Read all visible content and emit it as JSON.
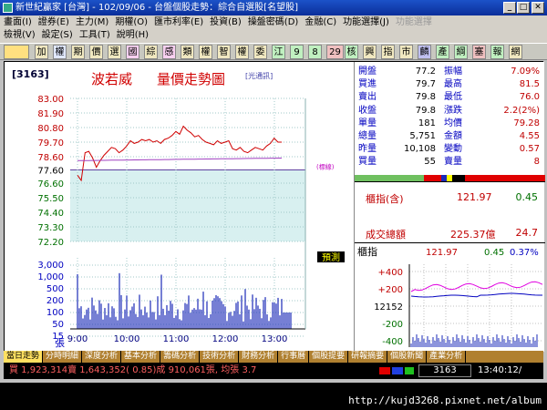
{
  "window": {
    "title": "新世紀贏家 [台灣] - 102/09/06 - 台盤個股走勢：綜合自選股[名望股]",
    "min": "_",
    "max": "□",
    "close": "✕"
  },
  "menu": {
    "row1": [
      "畫面(I)",
      "證券(E)",
      "主力(M)",
      "期權(O)",
      "匯市利率(E)",
      "投資(B)",
      "操盤密碼(D)",
      "金融(C)",
      "功能選擇(J)",
      "功能選擇"
    ],
    "row2": [
      "檢視(V)",
      "設定(S)",
      "工具(T)",
      "說明(H)"
    ]
  },
  "toolbar": {
    "buttons": [
      "加",
      "權",
      "期",
      "價",
      "選",
      "國",
      "綜",
      "感",
      "類",
      "權",
      "智",
      "權",
      "委",
      "江",
      "9",
      "8",
      "29",
      "核",
      "興",
      "指",
      "市",
      "麟",
      "產",
      "綱",
      "塞",
      "報",
      "網"
    ]
  },
  "chart": {
    "ticker": "[3163]",
    "name": "波若威",
    "title": "量價走勢圖",
    "subtitle": "[光通訊]",
    "ref_note": "(標線)",
    "forecast_label": "預測",
    "vol_unit_label": "張",
    "price_ticks": [
      "83.00",
      "81.90",
      "80.80",
      "79.70",
      "78.60",
      "77.60",
      "76.60",
      "75.50",
      "74.40",
      "73.30",
      "72.20"
    ],
    "volume_ticks": [
      "3,000",
      "1,000",
      "500",
      "200",
      "100",
      "50",
      "15"
    ],
    "time_ticks": [
      "9:00",
      "10:00",
      "11:00",
      "12:00",
      "13:00"
    ]
  },
  "chart_data": {
    "type": "line",
    "title": "量價走勢圖",
    "x": [
      "9:00",
      "9:05",
      "9:10",
      "9:15",
      "9:20",
      "9:25",
      "9:30",
      "9:35",
      "9:40",
      "9:45",
      "9:50",
      "9:55",
      "10:00",
      "10:05",
      "10:10",
      "10:15",
      "10:20",
      "10:25",
      "10:30",
      "10:35",
      "10:40",
      "10:45",
      "10:50",
      "10:55",
      "11:00",
      "11:05",
      "11:10",
      "11:15",
      "11:20",
      "11:25",
      "11:30",
      "11:35",
      "11:40",
      "11:45",
      "11:50",
      "11:55",
      "12:00",
      "12:05",
      "12:10",
      "12:15",
      "12:20",
      "12:25",
      "12:30",
      "12:35",
      "12:40",
      "12:45",
      "12:50",
      "12:55",
      "13:00",
      "13:05",
      "13:10",
      "13:15",
      "13:20",
      "13:25",
      "13:30"
    ],
    "series": [
      {
        "values": [
          77.2,
          76.8,
          78.9,
          79.0,
          78.5,
          77.8,
          78.3,
          78.7,
          79.0,
          79.3,
          79.2,
          78.9,
          79.1,
          79.4,
          79.8,
          79.6,
          79.7,
          79.9,
          79.8,
          79.9,
          79.7,
          79.8,
          79.6,
          79.9,
          80.0,
          80.2,
          80.5,
          80.3,
          80.9,
          80.6,
          80.4,
          80.1,
          80.2,
          79.9,
          79.7,
          79.6,
          79.5,
          79.8,
          79.6,
          79.7,
          79.8,
          79.2,
          79.1,
          79.3,
          79.0,
          78.9,
          79.1,
          79.3,
          79.2,
          79.1,
          79.4,
          79.6,
          80.0,
          79.7,
          79.7
        ]
      }
    ],
    "ylim": [
      72.2,
      83.0
    ],
    "reference_price": 77.6
  },
  "quote": {
    "rows": [
      {
        "l1": "開盤",
        "v1": "77.2",
        "l2": "振幅",
        "v2": "7.09%"
      },
      {
        "l1": "買進",
        "v1": "79.7",
        "l2": "最高",
        "v2": "81.5"
      },
      {
        "l1": "賣出",
        "v1": "79.8",
        "l2": "最低",
        "v2": "76.0"
      },
      {
        "l1": "收盤",
        "v1": "79.8",
        "l2": "漲跌",
        "v2": "2.2(2%)"
      },
      {
        "l1": "單量",
        "v1": "181",
        "l2": "均價",
        "v2": "79.28"
      },
      {
        "l1": "總量",
        "v1": "5,751",
        "l2": "金額",
        "v2": "4.55"
      },
      {
        "l1": "昨量",
        "v1": "10,108",
        "l2": "變動",
        "v2": "0.57"
      },
      {
        "l1": "買量",
        "v1": "55",
        "l2": "賣量",
        "v2": "8"
      }
    ]
  },
  "index": {
    "label": "櫃指(含)",
    "value": "121.97",
    "change": "0.45",
    "vol_label": "成交總額",
    "vol_value": "225.37億",
    "vol_change": "24.7"
  },
  "index_chart": {
    "label": "櫃指",
    "value": "121.97",
    "change": "0.45",
    "pct": "0.37%",
    "ticks": [
      "+400",
      "+200",
      "12152",
      "-200",
      "-400"
    ]
  },
  "tabs": [
    "當日走勢",
    "分時明細",
    "深度分析",
    "基本分析",
    "籌碼分析",
    "技術分析",
    "財務分析",
    "行事曆",
    "個股提要",
    "研報摘要",
    "個股新聞",
    "產業分析"
  ],
  "status": {
    "text": "買 1,923,314賣 1,643,352( 0.85)成 910,061張, 均張 3.7",
    "code": "3163",
    "time": "13:40:12/"
  },
  "watermark": "http://kujd3268.pixnet.net/album"
}
